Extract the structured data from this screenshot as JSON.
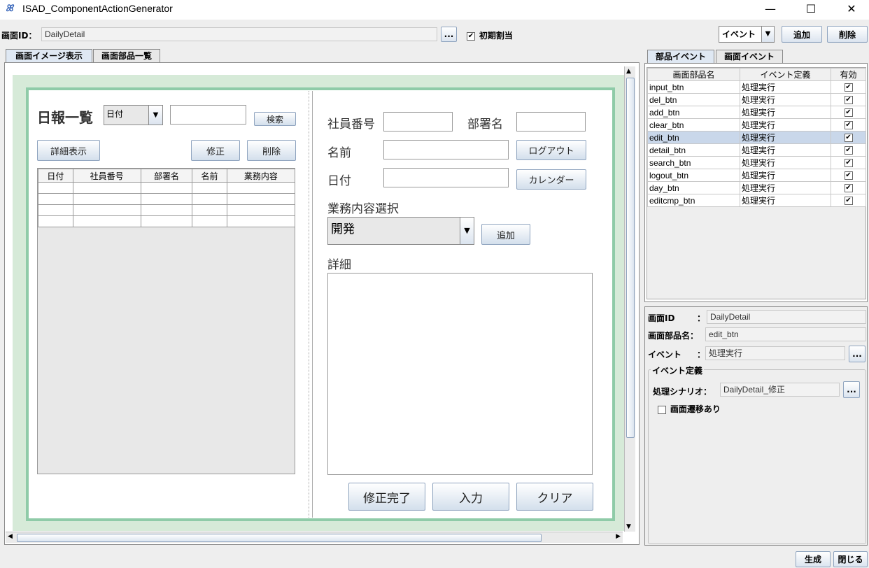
{
  "window": {
    "title": "ISAD_ComponentActionGenerator",
    "minimize": "—",
    "maximize": "☐",
    "close": "✕"
  },
  "header": {
    "screen_id_label": "画面ID：",
    "screen_id_value": "DailyDetail",
    "browse_label": "...",
    "initial_assign_label": "初期割当",
    "initial_assign_checked": "✔",
    "event_select": "イベント",
    "add_button": "追加",
    "delete_button": "削除"
  },
  "left_tabs": [
    "画面イメージ表示",
    "画面部品一覧"
  ],
  "design": {
    "list_title": "日報一覧",
    "date_combo": "日付",
    "search_button": "検索",
    "detail_button": "詳細表示",
    "edit_button": "修正",
    "delete_button": "削除",
    "table_headers": [
      "日付",
      "社員番号",
      "部署名",
      "名前",
      "業務内容"
    ],
    "emp_no_label": "社員番号",
    "dept_label": "部署名",
    "name_label": "名前",
    "logout_button": "ログアウト",
    "date_label": "日付",
    "calendar_button": "カレンダー",
    "work_select_label": "業務内容選択",
    "work_combo": "開発",
    "add_button": "追加",
    "detail_label": "詳細",
    "edit_complete_button": "修正完了",
    "input_button": "入力",
    "clear_button": "クリア"
  },
  "right_tabs": [
    "部品イベント",
    "画面イベント"
  ],
  "event_table": {
    "headers": [
      "画面部品名",
      "イベント定義",
      "有効"
    ],
    "rows": [
      {
        "name": "input_btn",
        "event": "処理実行",
        "enabled": "✔"
      },
      {
        "name": "del_btn",
        "event": "処理実行",
        "enabled": "✔"
      },
      {
        "name": "add_btn",
        "event": "処理実行",
        "enabled": "✔"
      },
      {
        "name": "clear_btn",
        "event": "処理実行",
        "enabled": "✔"
      },
      {
        "name": "edit_btn",
        "event": "処理実行",
        "enabled": "✔"
      },
      {
        "name": "detail_btn",
        "event": "処理実行",
        "enabled": "✔"
      },
      {
        "name": "search_btn",
        "event": "処理実行",
        "enabled": "✔"
      },
      {
        "name": "logout_btn",
        "event": "処理実行",
        "enabled": "✔"
      },
      {
        "name": "day_btn",
        "event": "処理実行",
        "enabled": "✔"
      },
      {
        "name": "editcmp_btn",
        "event": "処理実行",
        "enabled": "✔"
      }
    ],
    "selected_index": 4
  },
  "detail": {
    "screen_id_label": "画面ID",
    "screen_id_value": "DailyDetail",
    "part_name_label": "画面部品名：",
    "part_name_value": "edit_btn",
    "event_label": "イベント",
    "event_value": "処理実行",
    "event_def_group": "イベント定義",
    "scenario_label": "処理シナリオ：",
    "scenario_value": "DailyDetail_修正",
    "transition_label": "画面遷移あり",
    "colon": "："
  },
  "footer": {
    "generate_button": "生成",
    "close_button": "閉じる"
  },
  "colors": {
    "design_border": "#8fcba8",
    "design_bg": "#d6ead8",
    "selection": "#c9d7ea"
  }
}
